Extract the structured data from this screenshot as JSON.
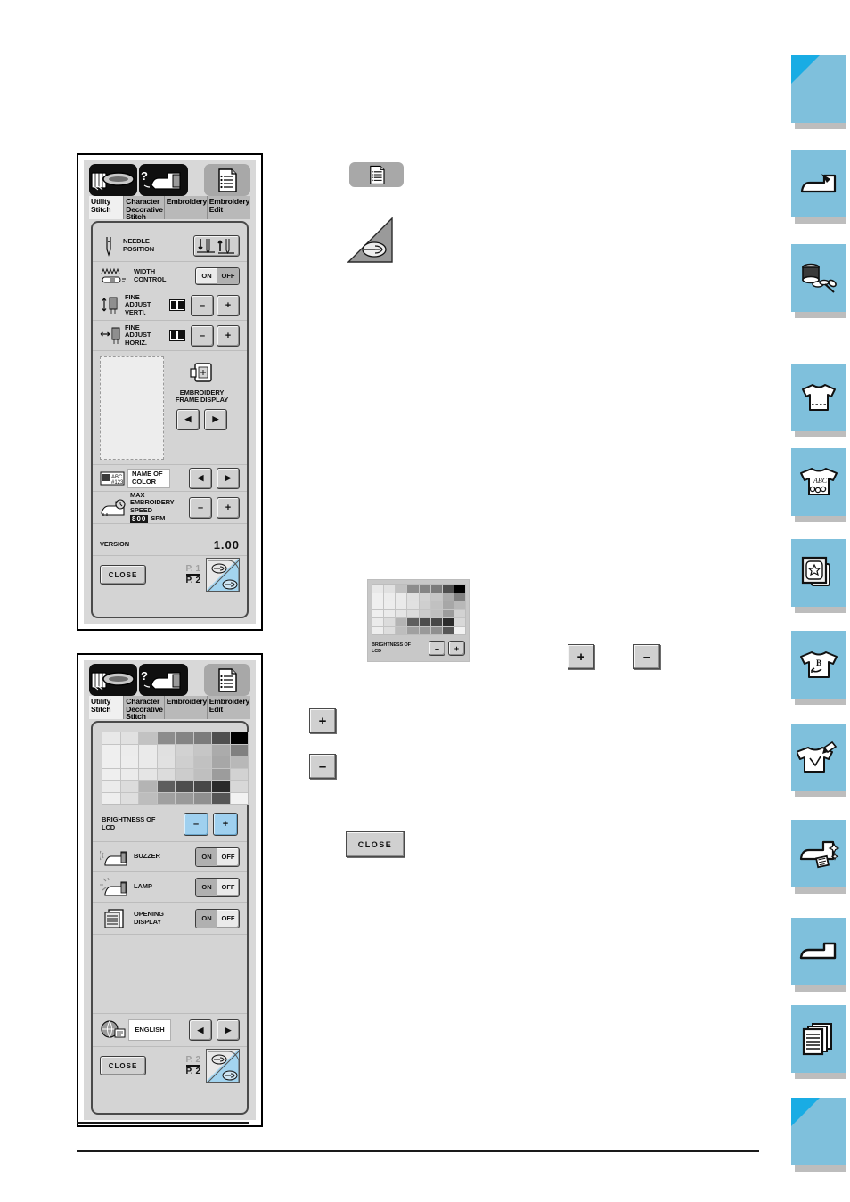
{
  "panels": [
    {
      "id": "settings-page-1",
      "tabs": [
        {
          "label": "Utility\nStitch",
          "active": true,
          "icon": "utility-stitch-icon"
        },
        {
          "label": "Character\nDecorative\nStitch",
          "active": false,
          "icon": "character-stitch-icon"
        },
        {
          "label": "Embroidery",
          "active": false,
          "icon": "embroidery-icon"
        },
        {
          "label": "Embroidery\nEdit",
          "active": false,
          "icon": "embroidery-edit-icon"
        }
      ],
      "rows": [
        {
          "label": "NEEDLE\nPOSITION",
          "control": "needle-position-toggle",
          "icon": "needle-icon"
        },
        {
          "label": "WIDTH\nCONTROL",
          "control": "on-off",
          "selected": "OFF",
          "on": "ON",
          "off": "OFF",
          "icon": "width-control-icon"
        },
        {
          "label": "FINE\nADJUST\nVERTI.",
          "control": "minus-plus",
          "minus": "–",
          "plus": "+",
          "icon": "fine-adjust-vert-icon"
        },
        {
          "label": "FINE\nADJUST\nHORIZ.",
          "control": "minus-plus",
          "minus": "–",
          "plus": "+",
          "icon": "fine-adjust-horiz-icon"
        }
      ],
      "frame_display": {
        "label": "EMBROIDERY\nFRAME DISPLAY",
        "prev": "◀",
        "next": "▶"
      },
      "name_of_color": {
        "label": "NAME OF\nCOLOR",
        "prev": "◀",
        "next": "▶",
        "icon": "color-name-icon"
      },
      "max_speed": {
        "label": "MAX\nEMBROIDERY\nSPEED",
        "value": "800",
        "unit": "SPM",
        "minus": "–",
        "plus": "+",
        "icon": "speed-icon"
      },
      "version": {
        "label": "VERSION",
        "value": "1.00"
      },
      "footer": {
        "close": "CLOSE",
        "page_current": "P. 1",
        "page_total": "P. 2",
        "turn_icon": "page-turn-hand-icon"
      }
    },
    {
      "id": "settings-page-2",
      "tabs": [
        {
          "label": "Utility\nStitch",
          "active": true,
          "icon": "utility-stitch-icon"
        },
        {
          "label": "Character\nDecorative\nStitch",
          "active": false,
          "icon": "character-stitch-icon"
        },
        {
          "label": "Embroidery",
          "active": false,
          "icon": "embroidery-icon"
        },
        {
          "label": "Embroidery\nEdit",
          "active": false,
          "icon": "embroidery-edit-icon"
        }
      ],
      "brightness": {
        "label": "BRIGHTNESS OF\nLCD",
        "minus": "–",
        "plus": "+"
      },
      "rows": [
        {
          "label": "BUZZER",
          "control": "on-off",
          "selected": "ON",
          "on": "ON",
          "off": "OFF",
          "icon": "buzzer-icon"
        },
        {
          "label": "LAMP",
          "control": "on-off",
          "selected": "ON",
          "on": "ON",
          "off": "OFF",
          "icon": "lamp-icon"
        },
        {
          "label": "OPENING\nDISPLAY",
          "control": "on-off",
          "selected": "ON",
          "on": "ON",
          "off": "OFF",
          "icon": "opening-display-icon"
        }
      ],
      "language": {
        "value": "ENGLISH",
        "prev": "◀",
        "next": "▶",
        "icon": "globe-language-icon"
      },
      "footer": {
        "close": "CLOSE",
        "page_current": "P. 2",
        "page_total": "P. 2",
        "turn_icon": "page-turn-hand-icon"
      }
    }
  ],
  "callouts": {
    "settings_key_icon": "settings-document-icon",
    "hand_pointer_icon": "hand-pointer-icon",
    "mini_brightness": {
      "label": "BRIGHTNESS OF\nLCD",
      "minus": "–",
      "plus": "+"
    },
    "plus_label": "+",
    "minus_label": "–",
    "close_label": "CLOSE"
  },
  "brightness_grid": {
    "cols": 8,
    "rows": [
      [
        "#e8e8e8",
        "#e1e1e1",
        "#c2c2c2",
        "#8c8c8c",
        "#848484",
        "#7b7b7b",
        "#4f4f4f",
        "#000000"
      ],
      [
        "#efefef",
        "#ececec",
        "#eaeaea",
        "#e0e0e0",
        "#d2d2d2",
        "#c6c6c6",
        "#ababab",
        "#808080"
      ],
      [
        "#efefef",
        "#ededed",
        "#eaeaea",
        "#e1e1e1",
        "#cfcfcf",
        "#c1c1c1",
        "#a7a7a7",
        "#b8b8b8"
      ],
      [
        "#efefef",
        "#ebebeb",
        "#e5e5e5",
        "#dcdcdc",
        "#cccccc",
        "#bfbfbf",
        "#9c9c9c",
        "#d2d2d2"
      ],
      [
        "#ebebeb",
        "#dcdcdc",
        "#b4b4b4",
        "#5e5e5e",
        "#4d4d4d",
        "#474747",
        "#2b2b2b",
        "#d8d8d8"
      ],
      [
        "#eeeeee",
        "#dedede",
        "#bdbdbd",
        "#a0a0a0",
        "#999999",
        "#8f8f8f",
        "#565656",
        "#f2f2f2"
      ]
    ]
  },
  "sidebar": {
    "items": [
      {
        "name": "sidebar-tab-cover",
        "icon": "blank-tab-icon",
        "blank": true
      },
      {
        "name": "sidebar-tab-machine",
        "icon": "sewing-machine-icon",
        "blank": false
      },
      {
        "name": "sidebar-tab-thread",
        "icon": "thread-spool-scissors-icon",
        "blank": false
      },
      {
        "name": "sidebar-tab-garment-plain",
        "icon": "plain-shirt-icon",
        "blank": false
      },
      {
        "name": "sidebar-tab-garment-abc",
        "icon": "abc-shirt-icon",
        "blank": false
      },
      {
        "name": "sidebar-tab-card",
        "icon": "embroidery-card-icon",
        "blank": false
      },
      {
        "name": "sidebar-tab-garment-edit",
        "icon": "shirt-letter-b-icon",
        "blank": false
      },
      {
        "name": "sidebar-tab-garment-pen",
        "icon": "shirt-pen-icon",
        "blank": false
      },
      {
        "name": "sidebar-tab-machine-sparkle",
        "icon": "machine-sparkle-icon",
        "blank": false
      },
      {
        "name": "sidebar-tab-machine-plain",
        "icon": "machine-plain-icon",
        "blank": false
      },
      {
        "name": "sidebar-tab-pages",
        "icon": "stacked-pages-icon",
        "blank": false
      },
      {
        "name": "sidebar-tab-back-cover",
        "icon": "blank-tab-icon",
        "blank": true
      }
    ]
  },
  "colors": {
    "sidebar_tile": "#7fc0dc",
    "sidebar_corner": "#19ace4",
    "lcd_background": "#d4d4d4",
    "accent_blue_button": "#9fd0ef"
  }
}
